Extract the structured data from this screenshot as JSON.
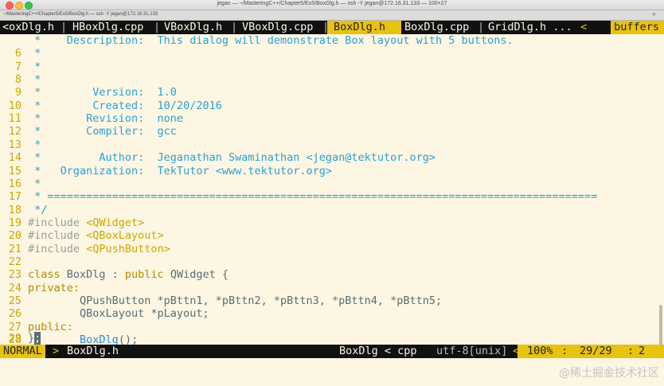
{
  "window": {
    "title": "jegan — ~/MasteringC++/Chapter5/Ex5/BoxDlg.h — ssh -Y jegan@172.16.31.133 — 100×27",
    "tab_label": "~/MasteringC++/Chapter5/Ex5/BoxDlg.h — ssh -Y jegan@172.16.31.133",
    "tab_plus": "+"
  },
  "buffers": {
    "items": [
      {
        "label": "<oxDlg.h"
      },
      {
        "label": "HBoxDlg.cpp"
      },
      {
        "label": "VBoxDlg.h"
      },
      {
        "label": "VBoxDlg.cpp"
      },
      {
        "label": "BoxDlg.h"
      },
      {
        "label": "BoxDlg.cpp"
      },
      {
        "label": "GridDlg.h ..."
      }
    ],
    "separator": "|",
    "arrow": "<",
    "buffers_label": "buffers"
  },
  "lines": [
    {
      "num": "",
      "text": " *    Description:  This dialog will demonstrate Box layout with 5 buttons."
    },
    {
      "num": "6",
      "text": " *"
    },
    {
      "num": "7",
      "text": " *"
    },
    {
      "num": "8",
      "text": " *"
    },
    {
      "num": "9",
      "text": " *        Version:  1.0"
    },
    {
      "num": "10",
      "text": " *        Created:  10/20/2016"
    },
    {
      "num": "11",
      "text": " *       Revision:  none"
    },
    {
      "num": "12",
      "text": " *       Compiler:  gcc"
    },
    {
      "num": "13",
      "text": " *"
    },
    {
      "num": "14",
      "text": " *         Author:  Jeganathan Swaminathan <jegan@tektutor.org>"
    },
    {
      "num": "15",
      "text": " *   Organization:  TekTutor <www.tektutor.org>"
    },
    {
      "num": "16",
      "text": " *"
    },
    {
      "num": "17",
      "text": " * ====================================================================================="
    },
    {
      "num": "18",
      "text": " */"
    },
    {
      "num": "19",
      "pp": "#include",
      "inc": " <QWidget>"
    },
    {
      "num": "20",
      "pp": "#include",
      "inc": " <QBoxLayout>"
    },
    {
      "num": "21",
      "pp": "#include",
      "inc": " <QPushButton>"
    },
    {
      "num": "22",
      "text": ""
    },
    {
      "num": "23",
      "kw1": "class",
      "mid": " BoxDlg : ",
      "kw2": "public",
      "tail": " QWidget {"
    },
    {
      "num": "24",
      "kw1": "private:"
    },
    {
      "num": "25",
      "plain": "        QPushButton *pBttn1, *pBttn2, *pBttn3, *pBttn4, *pBttn5;"
    },
    {
      "num": "26",
      "plain": "        QBoxLayout *pLayout;"
    },
    {
      "num": "27",
      "kw1": "public:"
    },
    {
      "num": "28",
      "pre": "        ",
      "fn": "BoxDlg",
      "post": "();"
    },
    {
      "num": "29",
      "end1": "}",
      "cursor": ";"
    }
  ],
  "status": {
    "mode": "NORMAL",
    "arrow_right": ">",
    "filename": "BoxDlg.h",
    "filetype": "BoxDlg < cpp",
    "encoding": "utf-8[unix]",
    "arrow_left": "<",
    "percent": "100%",
    "sep": ":",
    "line_col": "29/29",
    "sep2": ":",
    "col": "2"
  },
  "watermark": "@稀土掘金技术社区"
}
